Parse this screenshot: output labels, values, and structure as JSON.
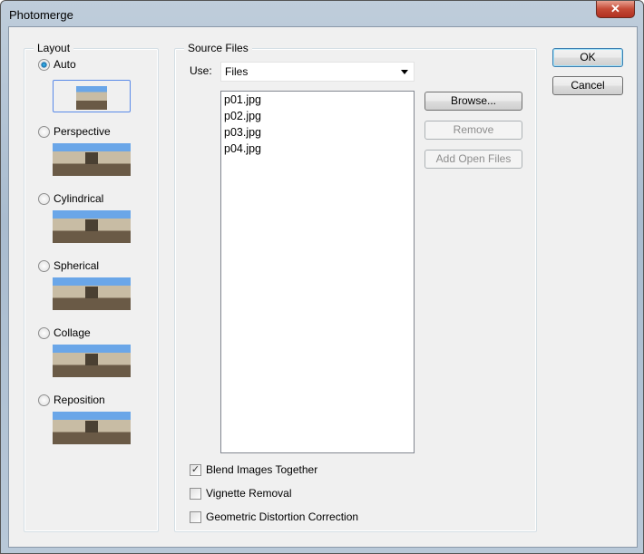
{
  "window": {
    "title": "Photomerge",
    "close": "✕"
  },
  "layout": {
    "label": "Layout",
    "selected": "Auto",
    "options": [
      {
        "label": "Auto",
        "checked": true
      },
      {
        "label": "Perspective",
        "checked": false
      },
      {
        "label": "Cylindrical",
        "checked": false
      },
      {
        "label": "Spherical",
        "checked": false
      },
      {
        "label": "Collage",
        "checked": false
      },
      {
        "label": "Reposition",
        "checked": false
      }
    ]
  },
  "source": {
    "label": "Source Files",
    "use_label": "Use:",
    "use_value": "Files",
    "files": [
      "p01.jpg",
      "p02.jpg",
      "p03.jpg",
      "p04.jpg"
    ],
    "browse": "Browse...",
    "remove": "Remove",
    "add_open": "Add Open Files"
  },
  "options": [
    {
      "label": "Blend Images Together",
      "checked": true
    },
    {
      "label": "Vignette Removal",
      "checked": false
    },
    {
      "label": "Geometric Distortion Correction",
      "checked": false
    }
  ],
  "buttons": {
    "ok": "OK",
    "cancel": "Cancel"
  }
}
